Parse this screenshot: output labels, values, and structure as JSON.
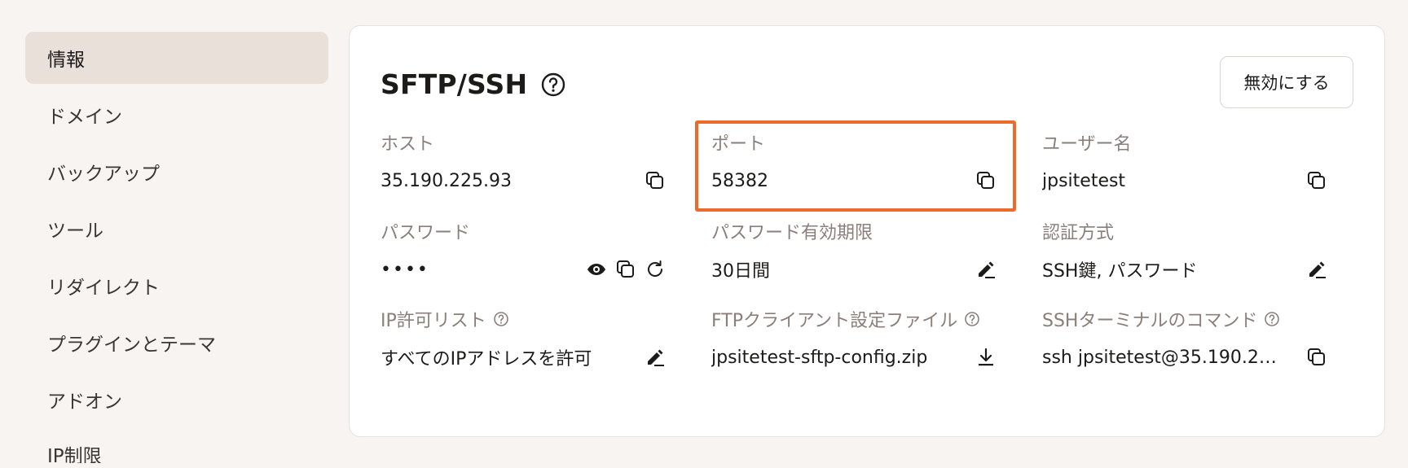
{
  "sidebar": {
    "items": [
      {
        "label": "情報",
        "active": true
      },
      {
        "label": "ドメイン"
      },
      {
        "label": "バックアップ"
      },
      {
        "label": "ツール"
      },
      {
        "label": "リダイレクト"
      },
      {
        "label": "プラグインとテーマ"
      },
      {
        "label": "アドオン"
      },
      {
        "label": "IP制限"
      }
    ]
  },
  "card": {
    "title": "SFTP/SSH",
    "disable_button": "無効にする",
    "fields": {
      "host": {
        "label": "ホスト",
        "value": "35.190.225.93"
      },
      "port": {
        "label": "ポート",
        "value": "58382"
      },
      "username": {
        "label": "ユーザー名",
        "value": "jpsitetest"
      },
      "password": {
        "label": "パスワード",
        "value": "••••"
      },
      "password_expiry": {
        "label": "パスワード有効期限",
        "value": "30日間"
      },
      "auth_method": {
        "label": "認証方式",
        "value": "SSH鍵, パスワード"
      },
      "ip_allow": {
        "label": "IP許可リスト",
        "value": "すべてのIPアドレスを許可"
      },
      "ftp_config": {
        "label": "FTPクライアント設定ファイル",
        "value": "jpsitetest-sftp-config.zip"
      },
      "ssh_command": {
        "label": "SSHターミナルのコマンド",
        "value": "ssh jpsitetest@35.190.225..."
      }
    }
  },
  "icons": {
    "copy": "copy-icon",
    "eye": "eye-icon",
    "refresh": "refresh-icon",
    "edit": "edit-icon",
    "download": "download-icon",
    "help": "help-circle-icon"
  },
  "colors": {
    "page_bg": "#f7f4f1",
    "active_item_bg": "#eae0da",
    "highlight": "#ec6a2c",
    "label": "#8a7f7a"
  }
}
